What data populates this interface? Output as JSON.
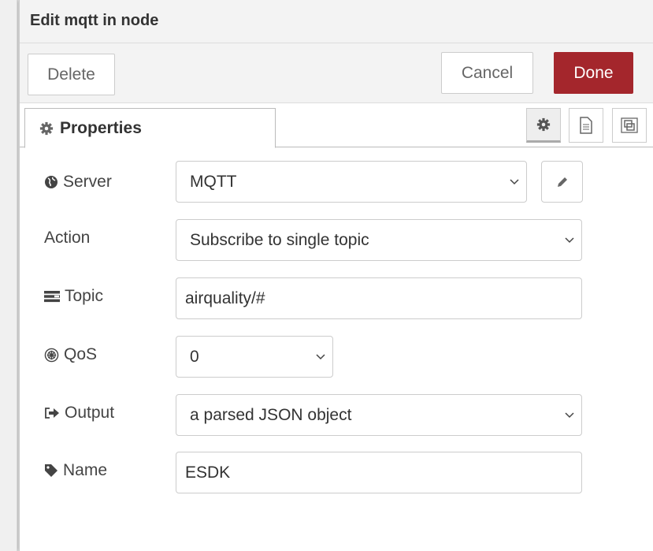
{
  "header": {
    "title": "Edit mqtt in node"
  },
  "tray": {
    "delete": "Delete",
    "cancel": "Cancel",
    "done": "Done"
  },
  "tabs": {
    "properties": "Properties"
  },
  "form": {
    "server": {
      "label": "Server",
      "value": "MQTT"
    },
    "action": {
      "label": "Action",
      "value": "Subscribe to single topic"
    },
    "topic": {
      "label": "Topic",
      "value": "airquality/#"
    },
    "qos": {
      "label": "QoS",
      "value": "0"
    },
    "output": {
      "label": "Output",
      "value": "a parsed JSON object"
    },
    "name": {
      "label": "Name",
      "value": "ESDK"
    }
  },
  "colors": {
    "done": "#a4262c"
  }
}
